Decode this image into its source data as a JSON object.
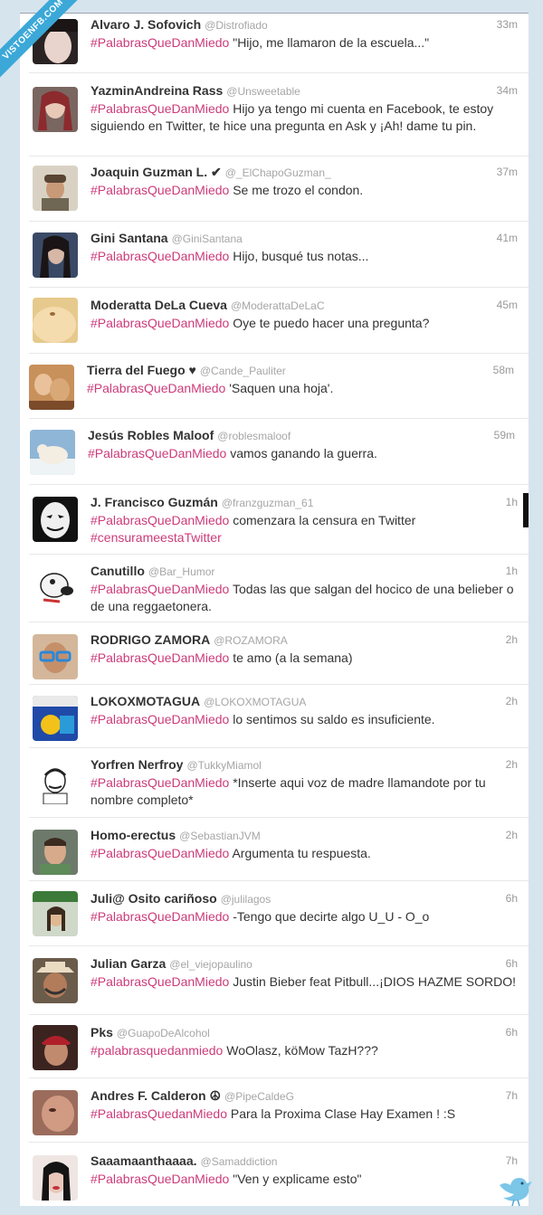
{
  "watermark": "VISTOENFB.COM",
  "tweets": [
    {
      "name": "Alvaro J. Sofovich",
      "handle": "@Distrofiado",
      "time": "33m",
      "hashtag": "#PalabrasQueDanMiedo",
      "text": " \"Hijo, me llamaron de la escuela...\"",
      "avatar": "face-pale-dark-hair"
    },
    {
      "name": "YazminAndreina Rass",
      "handle": "@Unsweetable",
      "time": "34m",
      "hashtag": "#PalabrasQueDanMiedo",
      "text": " Hijo ya tengo mi cuenta en Facebook, te estoy siguiendo en Twitter, te hice una pregunta en Ask y ¡Ah! dame tu pin.",
      "avatar": "girl-red-hair"
    },
    {
      "name": "Joaquin Guzman L. ✔",
      "handle": "@_ElChapoGuzman_",
      "time": "37m",
      "hashtag": "#PalabrasQueDanMiedo",
      "text": " Se me trozo el condon.",
      "avatar": "man-with-cap"
    },
    {
      "name": "Gini Santana",
      "handle": "@GiniSantana",
      "time": "41m",
      "hashtag": "#PalabrasQueDanMiedo",
      "text": " Hijo, busqué tus notas...",
      "avatar": "girl-dark-hair"
    },
    {
      "name": "Moderatta DeLa Cueva",
      "handle": "@ModerattaDeLaC",
      "time": "45m",
      "hashtag": "#PalabrasQueDanMiedo",
      "text": " Oye te puedo hacer una pregunta?",
      "avatar": "belly-closeup"
    },
    {
      "name": "Tierra del Fuego ♥",
      "handle": "@Cande_Pauliter",
      "time": "58m",
      "hashtag": "#PalabrasQueDanMiedo",
      "text": " 'Saquen una hoja'.",
      "avatar": "couple-photo"
    },
    {
      "name": "Jesús Robles Maloof",
      "handle": "@roblesmaloof",
      "time": "59m",
      "hashtag": "#PalabrasQueDanMiedo",
      "text": " vamos ganando la guerra.",
      "avatar": "polar-bear"
    },
    {
      "name": "J. Francisco Guzmán",
      "handle": "@franzguzman_61",
      "time": "1h",
      "hashtag": "#PalabrasQueDanMiedo",
      "text": " comenzara la censura en Twitter ",
      "hashtag2": "#censurameestaTwitter",
      "avatar": "guy-fawkes-mask"
    },
    {
      "name": "Canutillo",
      "handle": "@Bar_Humor",
      "time": "1h",
      "hashtag": "#PalabrasQueDanMiedo",
      "text": " Todas las que salgan del hocico de una belieber o de una reggaetonera.",
      "avatar": "cartoon-dog"
    },
    {
      "name": "RODRIGO ZAMORA",
      "handle": "@ROZAMORA",
      "time": "2h",
      "hashtag": "#PalabrasQueDanMiedo",
      "text": " te amo (a la semana)",
      "avatar": "man-blue-glasses"
    },
    {
      "name": "LOKOXMOTAGUA",
      "handle": "@LOKOXMOTAGUA",
      "time": "2h",
      "hashtag": "#PalabrasQueDanMiedo",
      "text": " lo sentimos su saldo es insuficiente.",
      "avatar": "blue-banner"
    },
    {
      "name": "Yorfren Nerfroy",
      "handle": "@TukkyMiamol",
      "time": "2h",
      "hashtag": "#PalabrasQueDanMiedo",
      "text": " *Inserte aqui voz de madre llamandote por tu nombre completo*",
      "avatar": "meme-drawing"
    },
    {
      "name": "Homo-erectus",
      "handle": "@SebastianJVM",
      "time": "2h",
      "hashtag": "#PalabrasQueDanMiedo",
      "text": " Argumenta tu respuesta.",
      "avatar": "young-man"
    },
    {
      "name": "Juli@ Osito cariñoso",
      "handle": "@julilagos",
      "time": "6h",
      "hashtag": "#PalabrasQueDanMiedo",
      "text": " -Tengo que decirte algo U_U - O_o",
      "avatar": "woman-at-desk"
    },
    {
      "name": "Julian Garza",
      "handle": "@el_viejopaulino",
      "time": "6h",
      "hashtag": "#PalabrasQueDanMiedo",
      "text": " Justin Bieber feat Pitbull...¡DIOS HAZME SORDO!",
      "avatar": "man-cowboy-hat"
    },
    {
      "name": "Pks",
      "handle": "@GuapoDeAlcohol",
      "time": "6h",
      "hashtag": "#palabrasquedanmiedo",
      "text": " WoOlasz, köMow TazH???",
      "avatar": "man-red-cap"
    },
    {
      "name": "Andres F. Calderon ☮",
      "handle": "@PipeCaldeG",
      "time": "7h",
      "hashtag": "#PalabrasQuedanMiedo",
      "text": " Para la Proxima Clase Hay Examen ! :S",
      "avatar": "blurry-face"
    },
    {
      "name": "Saaamaanthaaaa.",
      "handle": "@Samaddiction",
      "time": "7h",
      "hashtag": "#PalabrasQueDanMiedo",
      "text": " \"Ven y explicame esto\"",
      "avatar": "girl-black-hair"
    }
  ],
  "colors": {
    "hashtag": "#cc3b7a",
    "name": "#333333",
    "handle": "#a6a6a6",
    "background": "#d6e4ee"
  },
  "footer_icon": "twitter-bird-icon"
}
